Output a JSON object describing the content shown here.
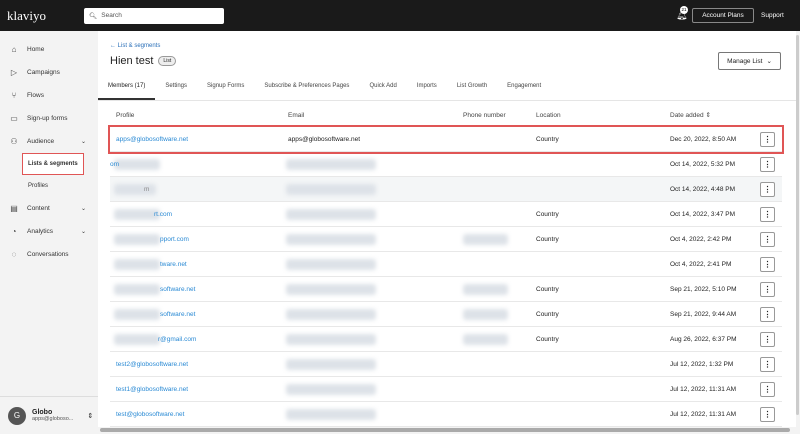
{
  "header": {
    "logo": "klaviyo",
    "search_placeholder": "Search",
    "notif_count": "21",
    "account_plans": "Account Plans",
    "support": "Support"
  },
  "sidebar": {
    "items": [
      {
        "icon": "⌂",
        "label": "Home"
      },
      {
        "icon": "▷",
        "label": "Campaigns"
      },
      {
        "icon": "⑂",
        "label": "Flows"
      },
      {
        "icon": "▭",
        "label": "Sign-up forms"
      },
      {
        "icon": "⚇",
        "label": "Audience"
      }
    ],
    "audience_sub": [
      "Lists & segments",
      "Profiles"
    ],
    "items2": [
      {
        "icon": "▤",
        "label": "Content"
      },
      {
        "icon": "◔",
        "label": "Analytics"
      },
      {
        "icon": "◌",
        "label": "Conversations"
      }
    ]
  },
  "user": {
    "initial": "G",
    "name": "Globo",
    "email": "apps@globoso..."
  },
  "page": {
    "back": "← List & segments",
    "title": "Hien test",
    "badge": "List",
    "manage": "Manage List"
  },
  "tabs": [
    "Members (17)",
    "Settings",
    "Signup Forms",
    "Subscribe & Preferences Pages",
    "Quick Add",
    "Imports",
    "List Growth",
    "Engagement"
  ],
  "columns": [
    "Profile",
    "Email",
    "Phone number",
    "Location",
    "Date added"
  ],
  "rows": [
    {
      "profile": "apps@globosoftware.net",
      "email": "apps@globosoftware.net",
      "location": "Country",
      "date": "Dec 20, 2022, 8:50 AM"
    },
    {
      "profile": "om",
      "email": "",
      "location": "",
      "date": "Oct 14, 2022, 5:32 PM"
    },
    {
      "profile": "m",
      "email": "",
      "location": "",
      "date": "Oct 14, 2022, 4:48 PM"
    },
    {
      "profile": "rt.com",
      "email": "",
      "location": "Country",
      "date": "Oct 14, 2022, 3:47 PM"
    },
    {
      "profile": "pport.com",
      "email": "",
      "location": "Country",
      "date": "Oct 4, 2022, 2:42 PM"
    },
    {
      "profile": "tware.net",
      "email": "",
      "location": "",
      "date": "Oct 4, 2022, 2:41 PM"
    },
    {
      "profile": "software.net",
      "email": "",
      "location": "Country",
      "date": "Sep 21, 2022, 5:10 PM"
    },
    {
      "profile": "software.net",
      "email": "",
      "location": "Country",
      "date": "Sep 21, 2022, 9:44 AM"
    },
    {
      "profile": "r@gmail.com",
      "email": "",
      "location": "Country",
      "date": "Aug 26, 2022, 6:37 PM"
    },
    {
      "profile": "test2@globosoftware.net",
      "email": "",
      "location": "",
      "date": "Jul 12, 2022, 1:32 PM"
    },
    {
      "profile": "test1@globosoftware.net",
      "email": "",
      "location": "",
      "date": "Jul 12, 2022, 11:31 AM"
    },
    {
      "profile": "test@globosoftware.net",
      "email": "",
      "location": "",
      "date": "Jul 12, 2022, 11:31 AM"
    }
  ]
}
